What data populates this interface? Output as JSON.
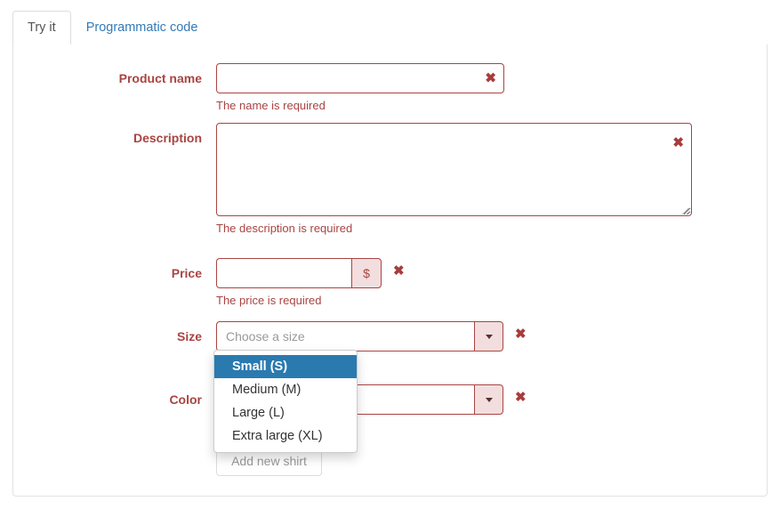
{
  "tabs": [
    {
      "label": "Try it",
      "active": true
    },
    {
      "label": "Programmatic code",
      "active": false
    }
  ],
  "form": {
    "product_name": {
      "label": "Product name",
      "value": "",
      "placeholder": "",
      "error": "The name is required",
      "clear_icon": "x-mark-icon"
    },
    "description": {
      "label": "Description",
      "value": "",
      "placeholder": "",
      "error": "The description is required",
      "clear_icon": "x-mark-icon"
    },
    "price": {
      "label": "Price",
      "value": "",
      "placeholder": "",
      "addon": "$",
      "error": "The price is required",
      "clear_icon": "x-mark-icon"
    },
    "size": {
      "label": "Size",
      "value": "",
      "placeholder": "Choose a size",
      "clear_icon": "x-mark-icon",
      "options": [
        {
          "label": "Small (S)",
          "selected": true
        },
        {
          "label": "Medium (M)",
          "selected": false
        },
        {
          "label": "Large (L)",
          "selected": false
        },
        {
          "label": "Extra large (XL)",
          "selected": false
        }
      ]
    },
    "color": {
      "label": "Color",
      "value": "",
      "placeholder": "",
      "clear_icon": "x-mark-icon"
    },
    "submit": {
      "label": "Add new shirt",
      "disabled": true
    }
  },
  "colors": {
    "error": "#a94442",
    "error_bg": "#f2dede",
    "link": "#337ab7",
    "highlight": "#2a7ab0",
    "border": "#dddddd"
  }
}
